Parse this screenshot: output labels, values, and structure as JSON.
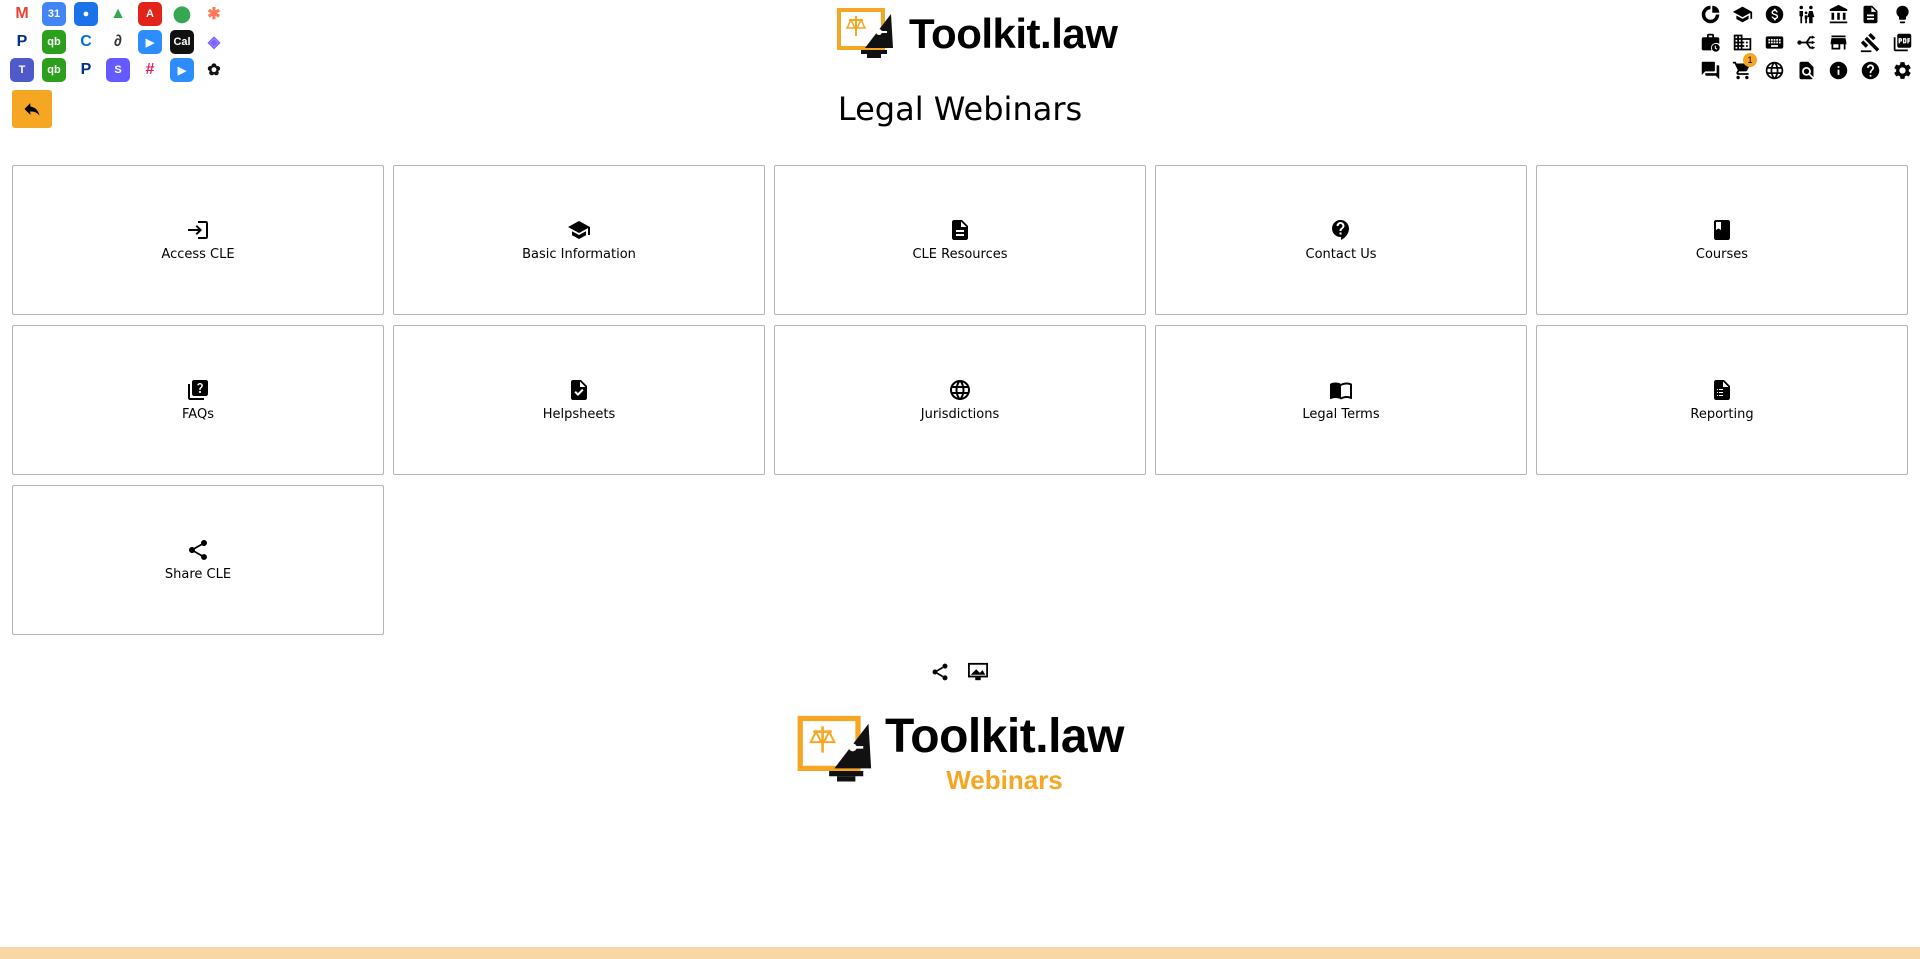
{
  "colors": {
    "accent": "#f5a623",
    "bottom_bar": "#f9d7a4",
    "card_border": "#b3b3b3"
  },
  "app_icons": [
    {
      "name": "gmail-icon",
      "glyph": "M",
      "bg": "#ffffff",
      "fg": "#ea4335"
    },
    {
      "name": "google-calendar-icon",
      "glyph": "31",
      "bg": "#4285f4",
      "fg": "#ffffff"
    },
    {
      "name": "google-contacts-icon",
      "glyph": "●",
      "bg": "#1a73e8",
      "fg": "#ffffff"
    },
    {
      "name": "google-drive-icon",
      "glyph": "▲",
      "bg": "#ffffff",
      "fg": "#34a853"
    },
    {
      "name": "adobe-acrobat-icon",
      "glyph": "A",
      "bg": "#e2231a",
      "fg": "#ffffff"
    },
    {
      "name": "google-maps-icon",
      "glyph": "⬤",
      "bg": "#ffffff",
      "fg": "#34a853"
    },
    {
      "name": "hubspot-icon",
      "glyph": "✱",
      "bg": "#ffffff",
      "fg": "#ff7a59"
    },
    {
      "name": "paypal-icon",
      "glyph": "P",
      "bg": "#ffffff",
      "fg": "#003087"
    },
    {
      "name": "quickbooks-icon",
      "glyph": "qb",
      "bg": "#2ca01c",
      "fg": "#ffffff"
    },
    {
      "name": "clio-icon",
      "glyph": "C",
      "bg": "#ffffff",
      "fg": "#0070e0"
    },
    {
      "name": "evernote-icon",
      "glyph": "∂",
      "bg": "#ffffff",
      "fg": "#333333"
    },
    {
      "name": "zoom-icon",
      "glyph": "▶",
      "bg": "#2d8cff",
      "fg": "#ffffff"
    },
    {
      "name": "cal-icon",
      "glyph": "Cal",
      "bg": "#111111",
      "fg": "#ffffff"
    },
    {
      "name": "copilot-icon",
      "glyph": "◈",
      "bg": "#ffffff",
      "fg": "#7b61ff"
    },
    {
      "name": "teams-icon",
      "glyph": "T",
      "bg": "#5059c9",
      "fg": "#ffffff"
    },
    {
      "name": "quickbooks-alt-icon",
      "glyph": "qb",
      "bg": "#2ca01c",
      "fg": "#ffffff"
    },
    {
      "name": "paypal-alt-icon",
      "glyph": "P",
      "bg": "#ffffff",
      "fg": "#003087"
    },
    {
      "name": "stripe-icon",
      "glyph": "S",
      "bg": "#635bff",
      "fg": "#ffffff"
    },
    {
      "name": "slack-icon",
      "glyph": "#",
      "bg": "#ffffff",
      "fg": "#e01e5a"
    },
    {
      "name": "zoom-alt-icon",
      "glyph": "▶",
      "bg": "#2d8cff",
      "fg": "#ffffff"
    },
    {
      "name": "openai-icon",
      "glyph": "✿",
      "bg": "#ffffff",
      "fg": "#111111"
    }
  ],
  "tool_rows": [
    [
      "analytics-icon",
      "graduation-icon",
      "dollar-icon",
      "family-icon",
      "bank-icon",
      "document-icon",
      "lightbulb-icon"
    ],
    [
      "briefcase-clock-icon",
      "building-icon",
      "keyboard-icon",
      "workflow-icon",
      "store-icon",
      "gavel-icon",
      "pdf-icon"
    ],
    [
      "chat-icon",
      "cart-icon",
      "globe-icon",
      "search-document-icon",
      "info-icon",
      "help-icon",
      "settings-icon"
    ]
  ],
  "cart_count": "1",
  "header": {
    "brand": "Toolkit.law"
  },
  "page": {
    "title": "Legal Webinars"
  },
  "cards": [
    {
      "name": "card-access-cle",
      "icon": "login-icon",
      "label": "Access CLE"
    },
    {
      "name": "card-basic-information",
      "icon": "graduation-cap-icon",
      "label": "Basic Information"
    },
    {
      "name": "card-cle-resources",
      "icon": "file-text-icon",
      "label": "CLE Resources"
    },
    {
      "name": "card-contact-us",
      "icon": "contact-help-icon",
      "label": "Contact Us"
    },
    {
      "name": "card-courses",
      "icon": "book-icon",
      "label": "Courses"
    },
    {
      "name": "card-faqs",
      "icon": "quiz-icon",
      "label": "FAQs"
    },
    {
      "name": "card-helpsheets",
      "icon": "file-check-icon",
      "label": "Helpsheets"
    },
    {
      "name": "card-jurisdictions",
      "icon": "globe-icon",
      "label": "Jurisdictions"
    },
    {
      "name": "card-legal-terms",
      "icon": "open-book-icon",
      "label": "Legal Terms"
    },
    {
      "name": "card-reporting",
      "icon": "report-icon",
      "label": "Reporting"
    },
    {
      "name": "card-share-cle",
      "icon": "share-icon",
      "label": "Share CLE"
    }
  ],
  "footer": {
    "brand": "Toolkit.law",
    "subtitle": "Webinars"
  }
}
